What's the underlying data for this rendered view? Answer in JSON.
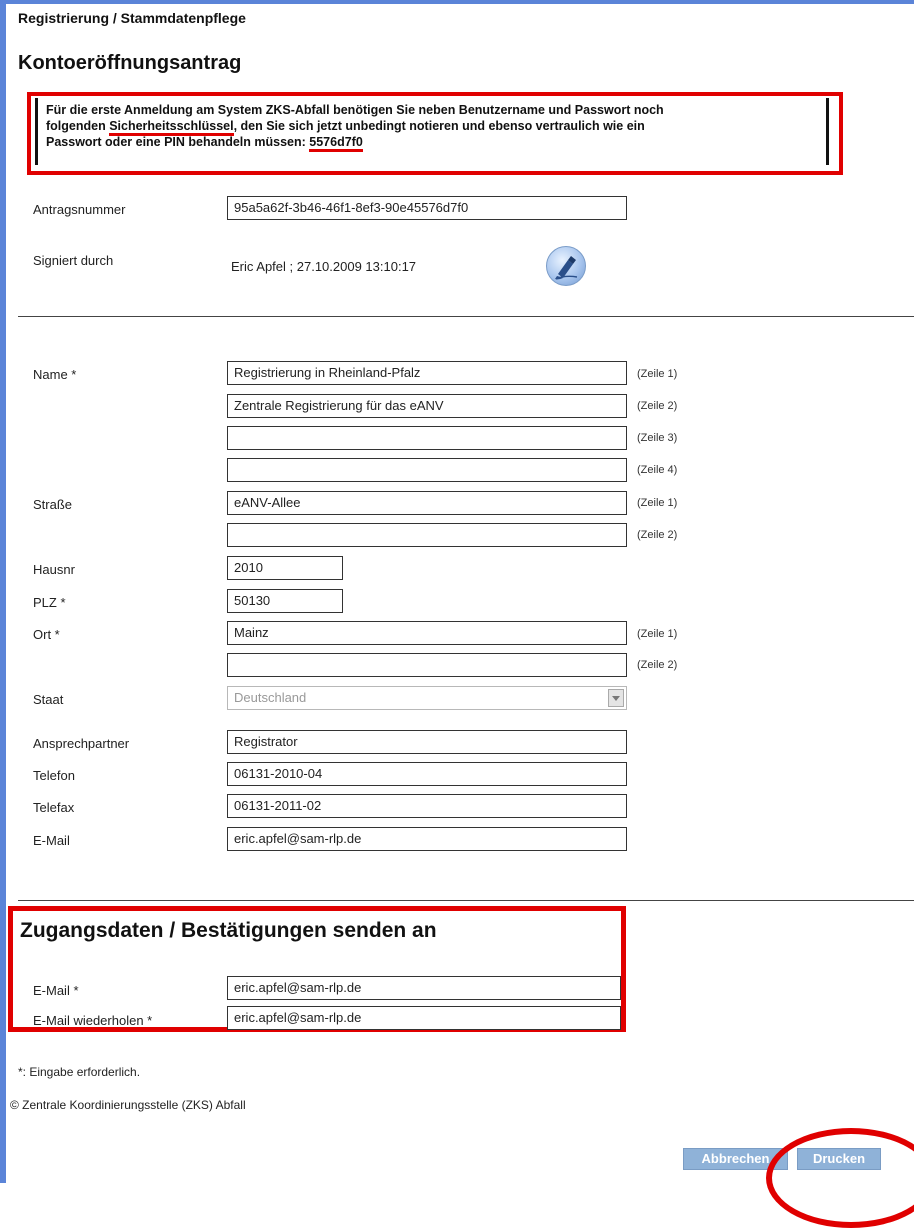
{
  "header": {
    "breadcrumb": "Registrierung / Stammdatenpflege",
    "title": "Kontoeröffnungsantrag"
  },
  "notice": {
    "line1": "Für die erste Anmeldung am System ZKS-Abfall benötigen Sie neben Benutzername und Passwort noch",
    "line2_prefix": "folgenden ",
    "line2_key_term": "Sicherheitsschlüssel",
    "line2_suffix": ", den Sie sich jetzt unbedingt notieren und ebenso vertraulich wie ein",
    "line3_prefix": "Passwort oder eine PIN behandeln müssen: ",
    "security_key": "5576d7f0"
  },
  "meta": {
    "antragsnummer_label": "Antragsnummer",
    "antragsnummer_value": "95a5a62f-3b46-46f1-8ef3-90e45576d7f0",
    "signiert_label": "Signiert durch",
    "signiert_value": "Eric Apfel ; 27.10.2009 13:10:17"
  },
  "form": {
    "name_label": "Name *",
    "name_lines": [
      "Registrierung in Rheinland-Pfalz",
      "Zentrale Registrierung für das eANV",
      "",
      ""
    ],
    "strasse_label": "Straße",
    "strasse_lines": [
      "eANV-Allee",
      ""
    ],
    "hausnr_label": "Hausnr",
    "hausnr_value": "2010",
    "plz_label": "PLZ *",
    "plz_value": "50130",
    "ort_label": "Ort *",
    "ort_lines": [
      "Mainz",
      ""
    ],
    "staat_label": "Staat",
    "staat_value": "Deutschland",
    "ansprechpartner_label": "Ansprechpartner",
    "ansprechpartner_value": "Registrator",
    "telefon_label": "Telefon",
    "telefon_value": "06131-2010-04",
    "telefax_label": "Telefax",
    "telefax_value": "06131-2011-02",
    "email_label": "E-Mail",
    "email_value": "eric.apfel@sam-rlp.de",
    "zeile_labels": [
      "(Zeile 1)",
      "(Zeile 2)",
      "(Zeile 3)",
      "(Zeile 4)"
    ]
  },
  "zugang": {
    "title": "Zugangsdaten / Bestätigungen senden an",
    "email_label": "E-Mail *",
    "email_value": "eric.apfel@sam-rlp.de",
    "email_repeat_label": "E-Mail wiederholen *",
    "email_repeat_value": "eric.apfel@sam-rlp.de"
  },
  "footer": {
    "required_note": "*: Eingabe erforderlich.",
    "copyright": "© Zentrale Koordinierungsstelle (ZKS) Abfall",
    "cancel_label": "Abbrechen",
    "print_label": "Drucken"
  },
  "icons": {
    "signature": "signature-pen-icon",
    "dropdown": "chevron-down-icon"
  },
  "colors": {
    "highlight_red": "#e00000",
    "frame_blue": "#5b84d8",
    "button_blue": "#8fb2d8"
  }
}
